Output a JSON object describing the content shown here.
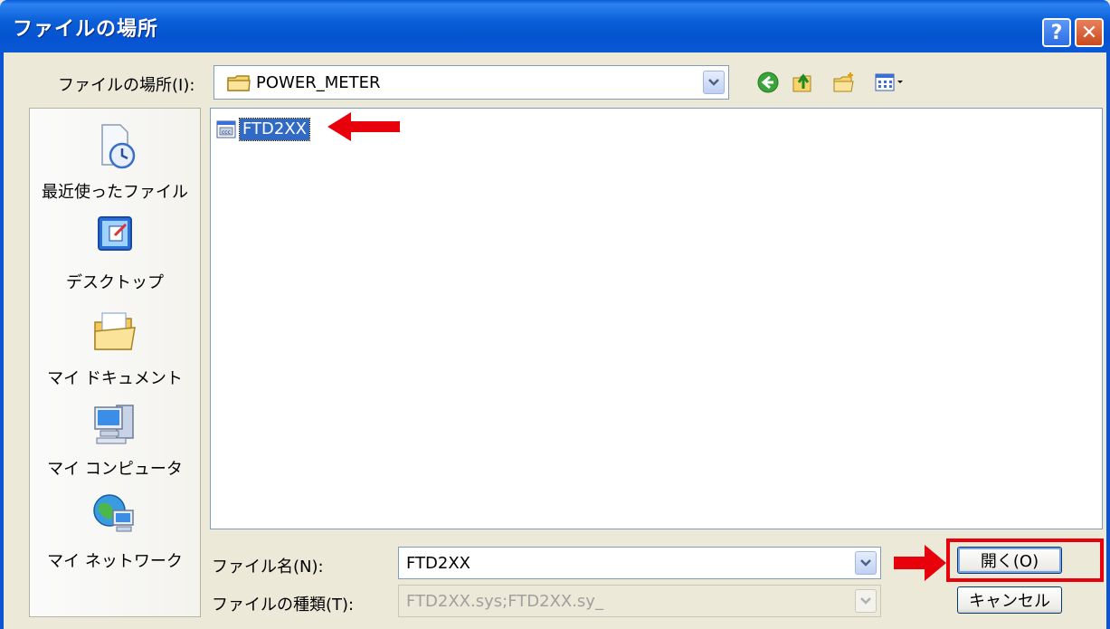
{
  "window": {
    "title": "ファイルの場所",
    "help_button": "?",
    "close_button": "✕"
  },
  "lookin": {
    "label": "ファイルの場所(I):",
    "value": "POWER_METER"
  },
  "places": [
    {
      "label": "最近使ったファイル",
      "icon": "recent-documents-icon"
    },
    {
      "label": "デスクトップ",
      "icon": "desktop-icon"
    },
    {
      "label": "マイ ドキュメント",
      "icon": "my-documents-icon"
    },
    {
      "label": "マイ コンピュータ",
      "icon": "my-computer-icon"
    },
    {
      "label": "マイ ネットワーク",
      "icon": "my-network-icon"
    }
  ],
  "files": [
    {
      "name": "FTD2XX",
      "icon": "system-file-icon",
      "selected": true
    }
  ],
  "filename": {
    "label": "ファイル名(N):",
    "value": "FTD2XX"
  },
  "filetype": {
    "label": "ファイルの種類(T):",
    "value": "FTD2XX.sys;FTD2XX.sy_"
  },
  "buttons": {
    "open": "開く(O)",
    "cancel": "キャンセル"
  },
  "colors": {
    "annotation": "#e8000b",
    "selection": "#316ac5",
    "titlebar": "#0a5fd8"
  }
}
